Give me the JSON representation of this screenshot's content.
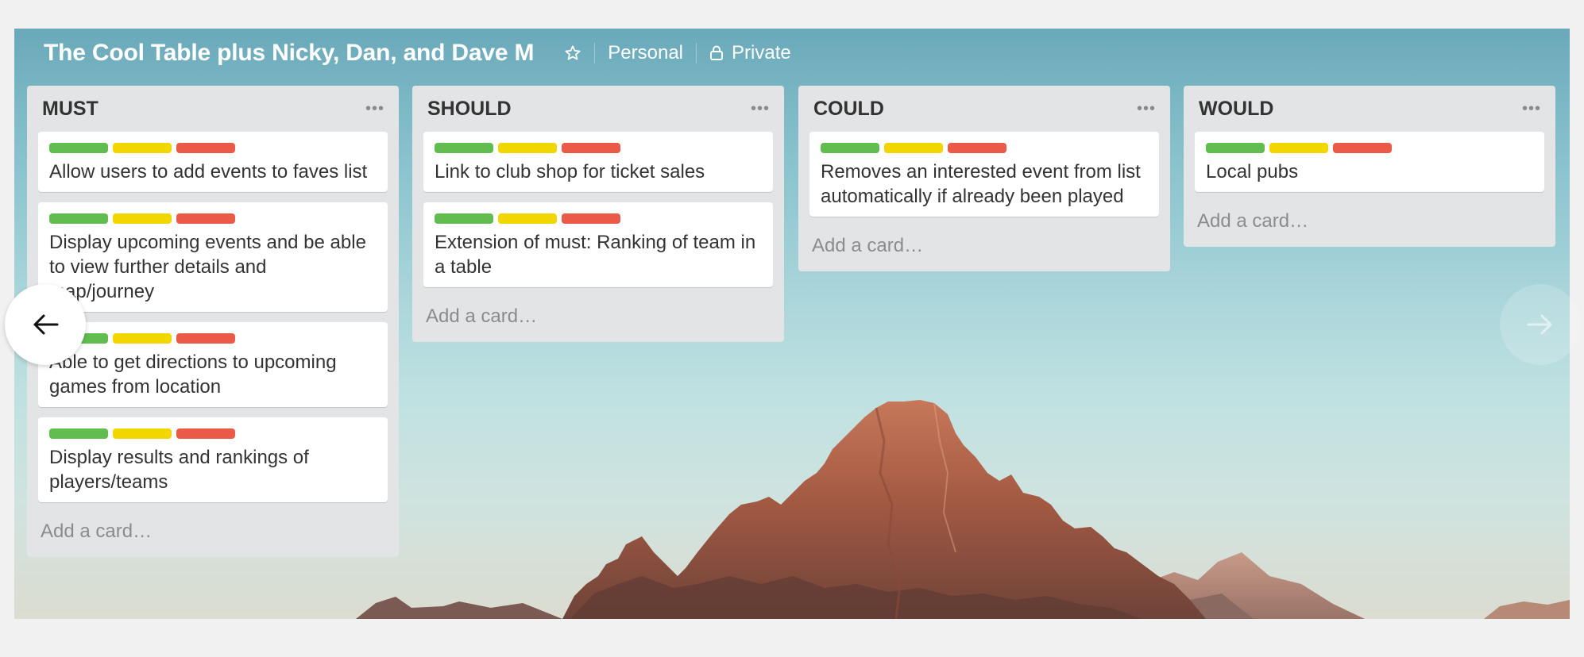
{
  "board": {
    "title": "The Cool Table plus Nicky, Dan, and Dave M",
    "team": "Personal",
    "visibility": "Private"
  },
  "colors": {
    "green": "#61bd4f",
    "yellow": "#f2d600",
    "red": "#eb5a46"
  },
  "lists": [
    {
      "title": "MUST",
      "add_card": "Add a card…",
      "cards": [
        {
          "text": "Allow users to add events to faves list"
        },
        {
          "text": "Display upcoming events and be able to view further details and map/journey"
        },
        {
          "text": "Able to get directions to upcoming games from location"
        },
        {
          "text": "Display results and rankings of players/teams"
        }
      ]
    },
    {
      "title": "SHOULD",
      "add_card": "Add a card…",
      "cards": [
        {
          "text": "Link to club shop for ticket sales"
        },
        {
          "text": "Extension of must: Ranking of team in a table"
        }
      ]
    },
    {
      "title": "COULD",
      "add_card": "Add a card…",
      "cards": [
        {
          "text": "Removes an interested event from list automatically if already been played"
        }
      ]
    },
    {
      "title": "WOULD",
      "add_card": "Add a card…",
      "cards": [
        {
          "text": "Local pubs"
        }
      ]
    }
  ],
  "icons": {
    "star": "star-icon",
    "lock": "lock-icon",
    "menu": "ellipsis-icon",
    "prev": "arrow-left-icon",
    "next": "arrow-right-icon"
  }
}
